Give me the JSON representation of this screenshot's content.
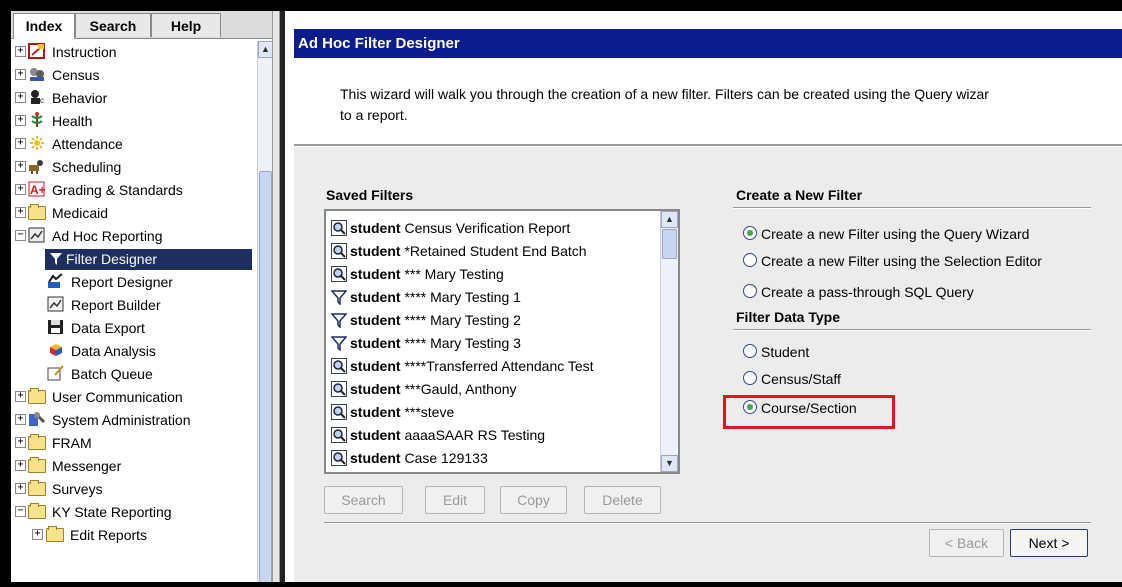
{
  "left_nav": {
    "tabs": [
      "Index",
      "Search",
      "Help"
    ],
    "tree": [
      {
        "label": "Instruction",
        "expander": "+",
        "icon": "instruction-icon"
      },
      {
        "label": "Census",
        "expander": "+",
        "icon": "census-icon"
      },
      {
        "label": "Behavior",
        "expander": "+",
        "icon": "behavior-icon"
      },
      {
        "label": "Health",
        "expander": "+",
        "icon": "health-icon"
      },
      {
        "label": "Attendance",
        "expander": "+",
        "icon": "attendance-icon"
      },
      {
        "label": "Scheduling",
        "expander": "+",
        "icon": "scheduling-icon"
      },
      {
        "label": "Grading & Standards",
        "expander": "+",
        "icon": "grading-icon"
      },
      {
        "label": "Medicaid",
        "expander": "+",
        "icon": "folder-icon"
      },
      {
        "label": "Ad Hoc Reporting",
        "expander": "−",
        "icon": "ad-hoc-reporting-icon"
      },
      {
        "label": "Filter Designer",
        "icon": "filter-icon"
      },
      {
        "label": "Report Designer",
        "icon": "report-designer-icon"
      },
      {
        "label": "Report Builder",
        "icon": "report-builder-icon"
      },
      {
        "label": "Data Export",
        "icon": "floppy-disk-icon"
      },
      {
        "label": "Data Analysis",
        "icon": "data-analysis-icon"
      },
      {
        "label": "Batch Queue",
        "icon": "batch-queue-icon"
      },
      {
        "label": "User Communication",
        "expander": "+",
        "icon": "folder-icon"
      },
      {
        "label": "System Administration",
        "expander": "+",
        "icon": "system-administration-icon"
      },
      {
        "label": "FRAM",
        "expander": "+",
        "icon": "folder-icon"
      },
      {
        "label": "Messenger",
        "expander": "+",
        "icon": "folder-icon"
      },
      {
        "label": "Surveys",
        "expander": "+",
        "icon": "folder-icon"
      },
      {
        "label": "KY State Reporting",
        "expander": "−",
        "icon": "folder-icon"
      },
      {
        "label": "Edit Reports",
        "expander": "+",
        "icon": "folder-icon"
      }
    ],
    "selected_item": "Filter Designer"
  },
  "main": {
    "title": "Ad Hoc Filter Designer",
    "intro_line1": "This wizard will walk you through the creation of a new filter. Filters can be created using the Query wizar",
    "intro_line2": "to a report.",
    "saved_filters": {
      "heading": "Saved Filters",
      "items": [
        {
          "type": "student",
          "name": " Census Verification Report",
          "icon": "query-magnifier-icon"
        },
        {
          "type": "student",
          "name": " *Retained Student End Batch",
          "icon": "query-magnifier-icon"
        },
        {
          "type": "student",
          "name": "*** Mary Testing",
          "icon": "query-magnifier-icon"
        },
        {
          "type": "student",
          "name": "**** Mary Testing 1",
          "icon": "filter-funnel-icon"
        },
        {
          "type": "student",
          "name": "**** Mary Testing 2",
          "icon": "filter-funnel-icon"
        },
        {
          "type": "student",
          "name": "**** Mary Testing 3",
          "icon": "filter-funnel-icon"
        },
        {
          "type": "student",
          "name": "****Transferred Attendanc Test",
          "icon": "query-magnifier-icon"
        },
        {
          "type": "student",
          "name": "***Gauld, Anthony",
          "icon": "query-magnifier-icon"
        },
        {
          "type": "student",
          "name": "***steve",
          "icon": "query-magnifier-icon"
        },
        {
          "type": "student",
          "name": "aaaaSAAR RS Testing",
          "icon": "query-magnifier-icon"
        },
        {
          "type": "student",
          "name": "Case 129133",
          "icon": "query-magnifier-icon"
        }
      ],
      "buttons": {
        "search": "Search",
        "edit": "Edit",
        "copy": "Copy",
        "delete": "Delete"
      }
    },
    "create_filter": {
      "heading": "Create a New Filter",
      "options": [
        {
          "label": "Create a new Filter using the Query Wizard",
          "selected": true
        },
        {
          "label": "Create a new Filter using the Selection Editor",
          "selected": false
        },
        {
          "label": "Create a pass-through SQL Query",
          "selected": false
        }
      ]
    },
    "filter_data_type": {
      "heading": "Filter Data Type",
      "options": [
        {
          "label": "Student",
          "selected": false
        },
        {
          "label": "Census/Staff",
          "selected": false
        },
        {
          "label": "Course/Section",
          "selected": true
        }
      ]
    },
    "nav_buttons": {
      "back": "< Back",
      "next": "Next >"
    },
    "colors": {
      "title_bg": "#0b1d8c",
      "selection_bg": "#1d2e5f",
      "highlight": "#e0141e",
      "radio_dot": "#3ea54b"
    }
  }
}
